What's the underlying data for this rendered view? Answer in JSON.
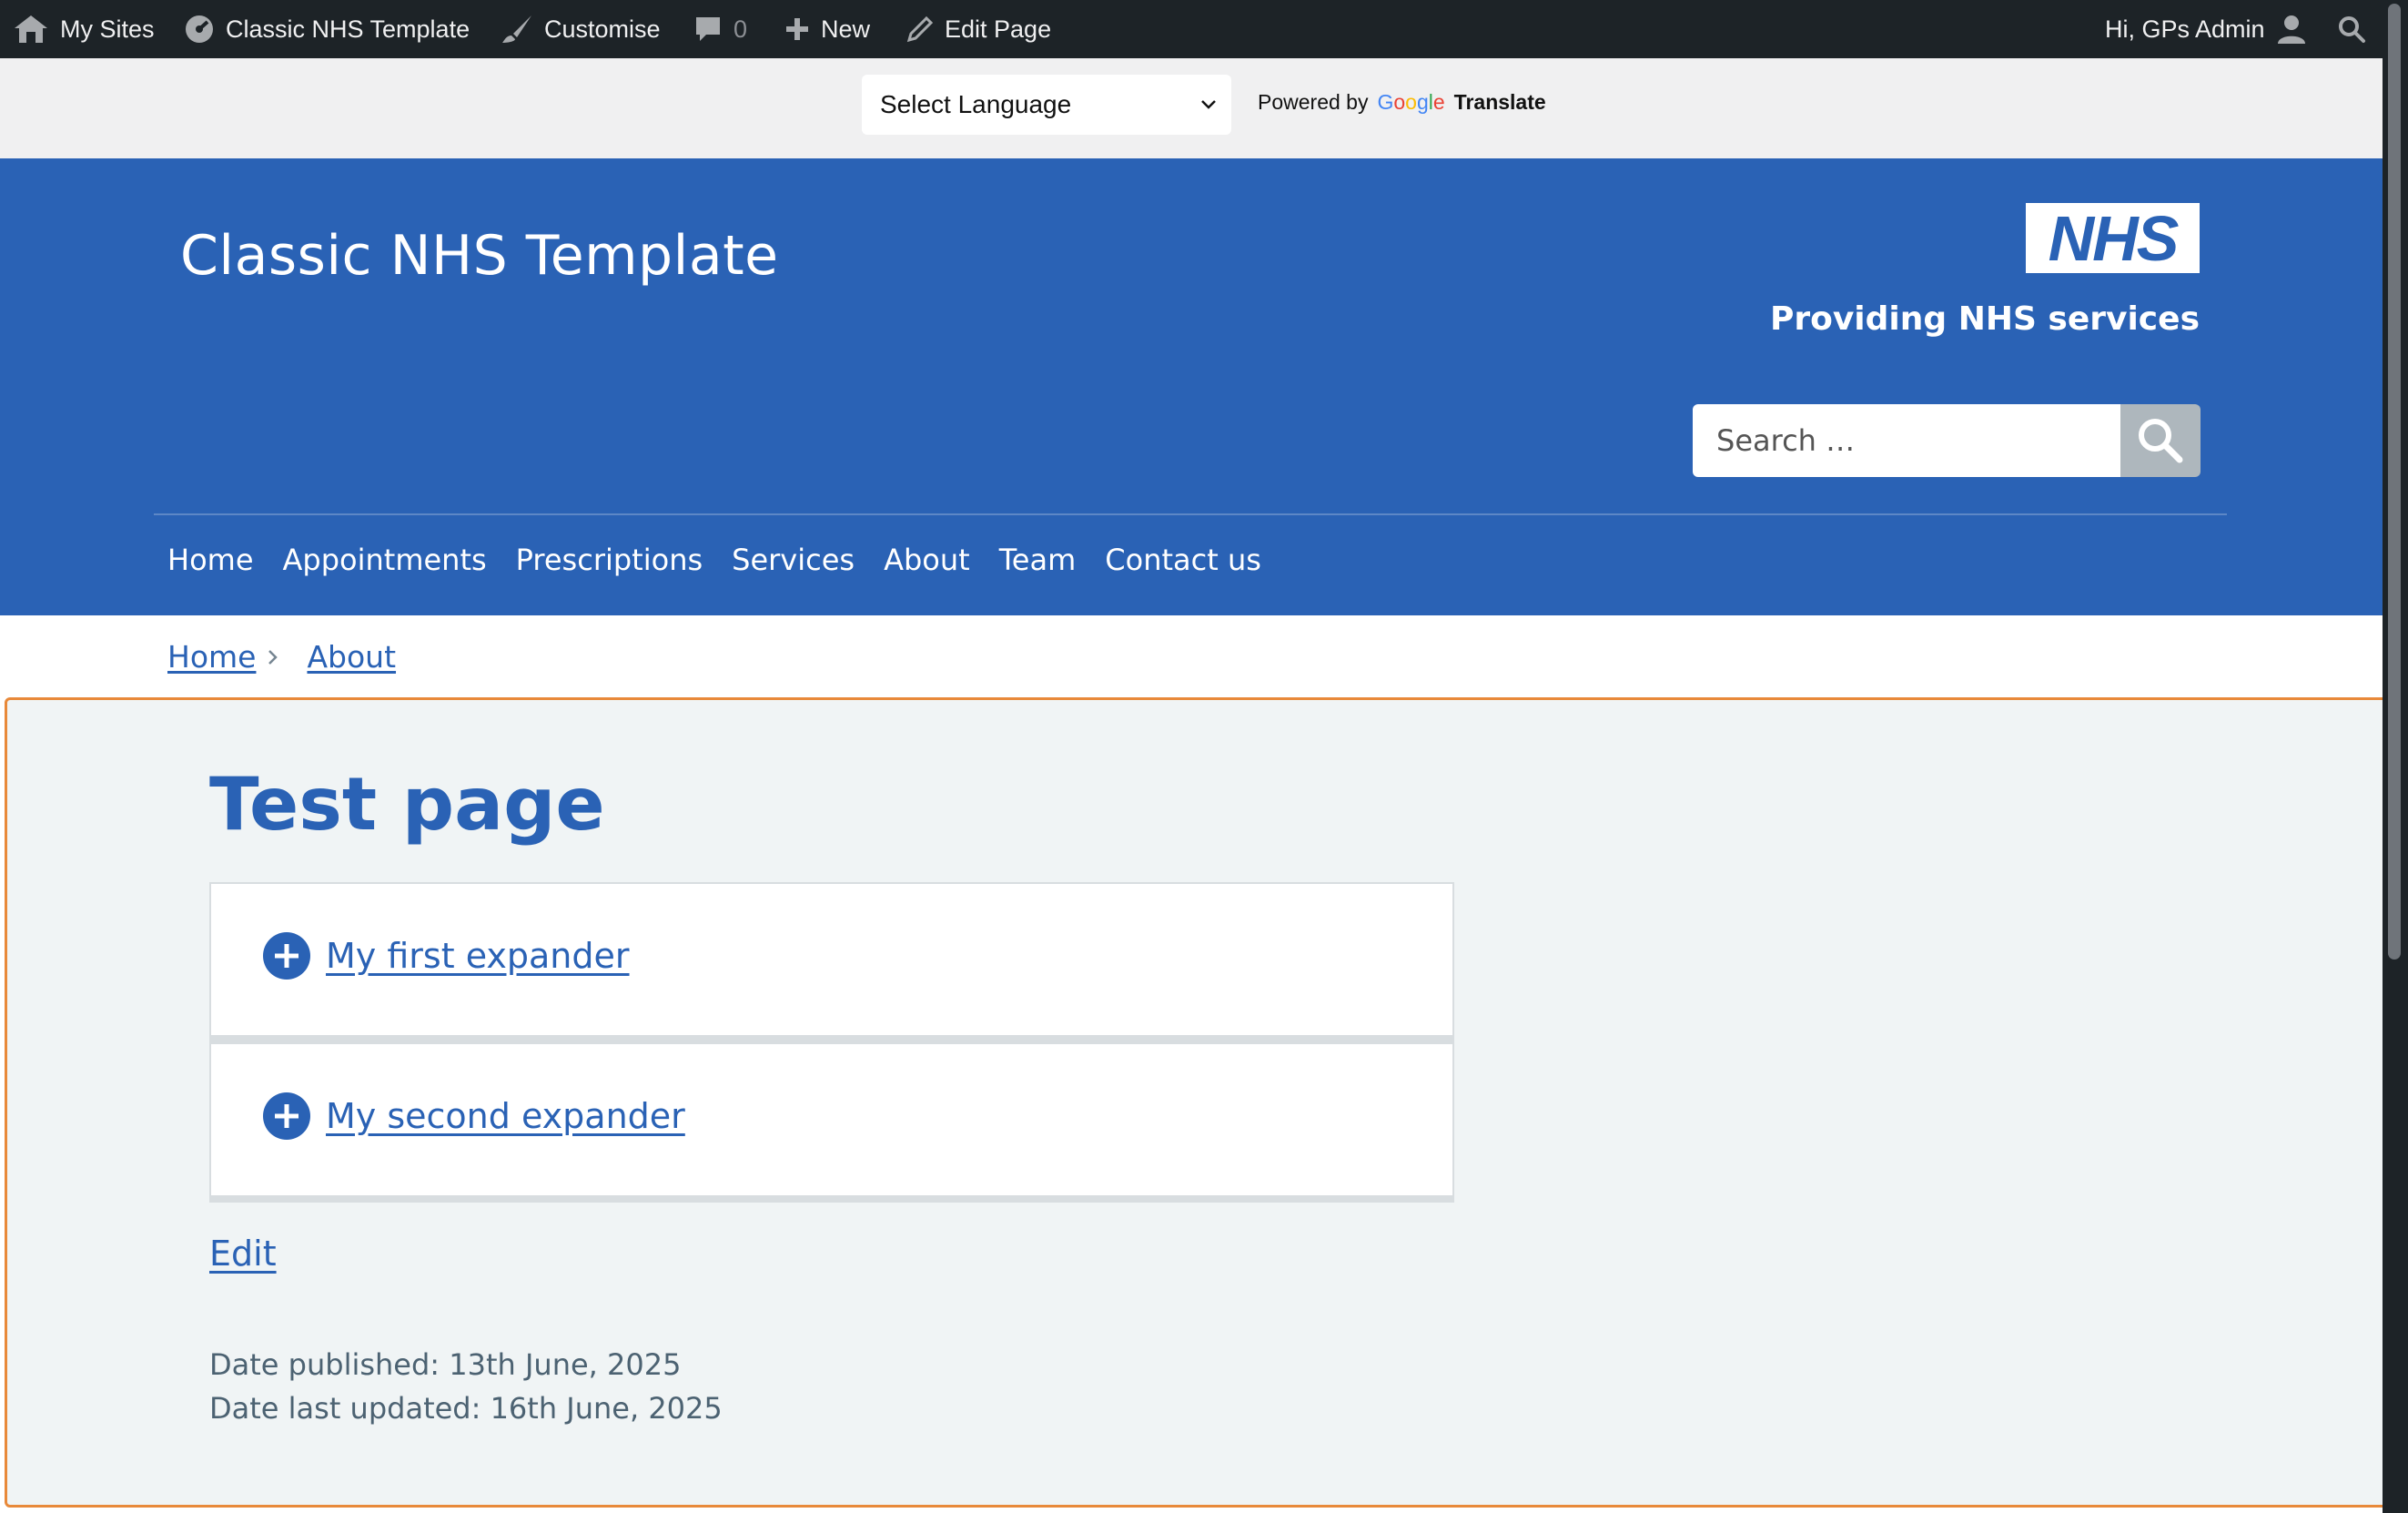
{
  "adminbar": {
    "my_sites": "My Sites",
    "site_name": "Classic NHS Template",
    "customise": "Customise",
    "comments_count": "0",
    "new": "New",
    "edit_page": "Edit Page",
    "greeting": "Hi, GPs Admin"
  },
  "translate": {
    "select_label": "Select Language",
    "powered_by": "Powered by",
    "google": "Google",
    "translate": "Translate"
  },
  "header": {
    "site_title": "Classic NHS Template",
    "logo_text": "NHS",
    "strapline": "Providing NHS services",
    "search_placeholder": "Search …"
  },
  "nav": {
    "items": [
      "Home",
      "Appointments",
      "Prescriptions",
      "Services",
      "About",
      "Team",
      "Contact us"
    ]
  },
  "breadcrumb": {
    "items": [
      "Home",
      "About"
    ]
  },
  "main": {
    "title": "Test page",
    "expanders": [
      "My first expander",
      "My second expander"
    ],
    "edit_label": "Edit",
    "date_published": "Date published: 13th June, 2025",
    "date_updated": "Date last updated: 16th June, 2025"
  },
  "colors": {
    "nhs_blue": "#2a62b5",
    "admin_bar": "#1d2327",
    "content_bg": "#f0f4f5",
    "focus_outline": "#e8893a"
  },
  "icons": [
    "wordpress-sites-icon",
    "dashboard-icon",
    "brush-icon",
    "comment-icon",
    "plus-icon",
    "pencil-icon",
    "user-icon",
    "search-icon",
    "chevron-down-icon",
    "chevron-right-icon",
    "plus-circle-icon"
  ]
}
